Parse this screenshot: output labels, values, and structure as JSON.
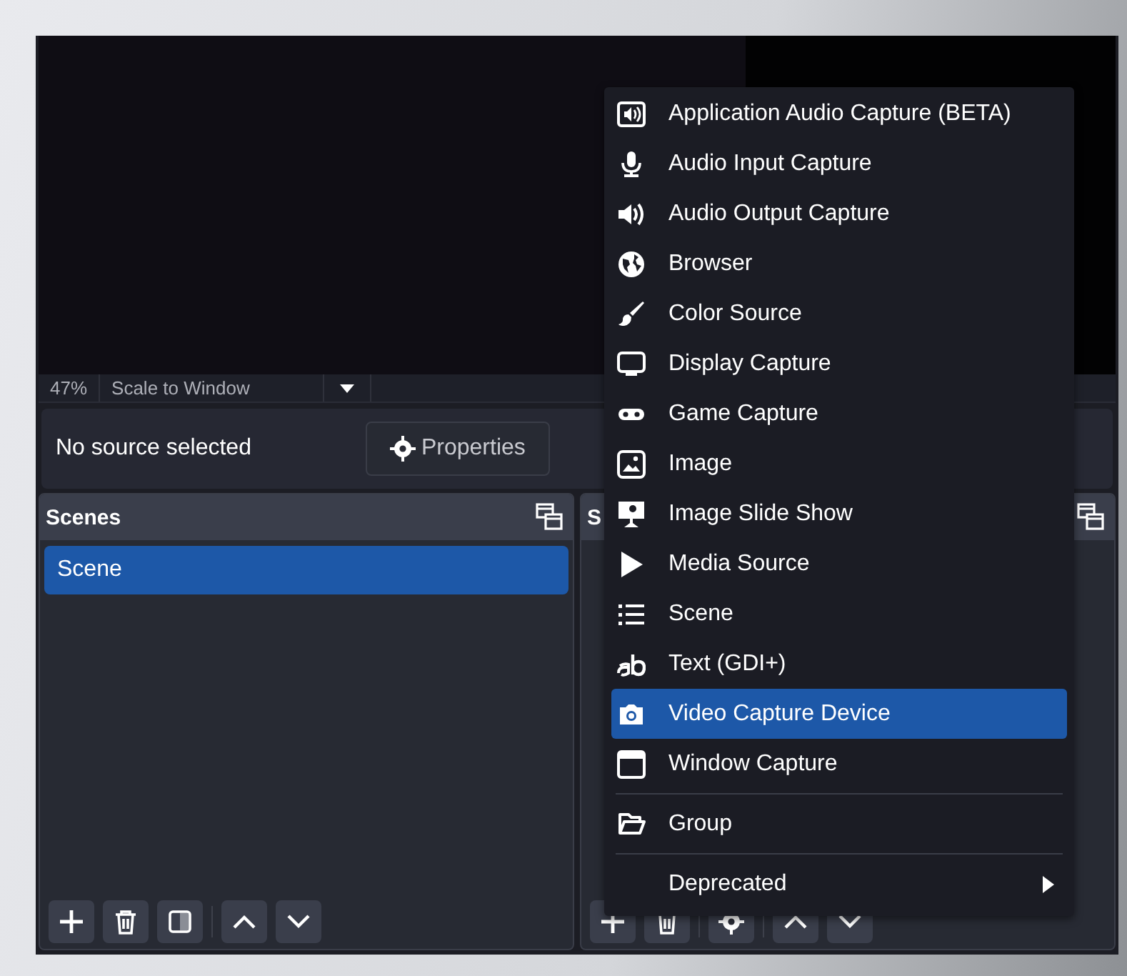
{
  "preview": {
    "zoom": "47%",
    "scale_mode": "Scale to Window"
  },
  "source_bar": {
    "status": "No source selected",
    "properties_button": "Properties"
  },
  "docks": [
    {
      "title": "Scenes",
      "items": [
        {
          "label": "Scene",
          "selected": true
        }
      ],
      "toolbar": [
        {
          "kind": "add"
        },
        {
          "kind": "remove"
        },
        {
          "kind": "filters"
        },
        {
          "kind": "separator"
        },
        {
          "kind": "up"
        },
        {
          "kind": "down"
        }
      ]
    },
    {
      "title": "S",
      "toolbar": [
        {
          "kind": "add"
        },
        {
          "kind": "remove"
        },
        {
          "kind": "separator"
        },
        {
          "kind": "settings"
        },
        {
          "kind": "separator"
        },
        {
          "kind": "up"
        },
        {
          "kind": "down"
        }
      ]
    }
  ],
  "add_source_menu": [
    {
      "kind": "item",
      "label": "Application Audio Capture (BETA)",
      "selected": false
    },
    {
      "kind": "item",
      "label": "Audio Input Capture",
      "selected": false
    },
    {
      "kind": "item",
      "label": "Audio Output Capture",
      "selected": false
    },
    {
      "kind": "item",
      "label": "Browser",
      "selected": false
    },
    {
      "kind": "item",
      "label": "Color Source",
      "selected": false
    },
    {
      "kind": "item",
      "label": "Display Capture",
      "selected": false
    },
    {
      "kind": "item",
      "label": "Game Capture",
      "selected": false
    },
    {
      "kind": "item",
      "label": "Image",
      "selected": false
    },
    {
      "kind": "item",
      "label": "Image Slide Show",
      "selected": false
    },
    {
      "kind": "item",
      "label": "Media Source",
      "selected": false
    },
    {
      "kind": "item",
      "label": "Scene",
      "selected": false
    },
    {
      "kind": "item",
      "label": "Text (GDI+)",
      "selected": false
    },
    {
      "kind": "item",
      "label": "Video Capture Device",
      "selected": true
    },
    {
      "kind": "item",
      "label": "Window Capture",
      "selected": false
    },
    {
      "kind": "separator"
    },
    {
      "kind": "item",
      "label": "Group",
      "selected": false
    },
    {
      "kind": "separator"
    },
    {
      "kind": "submenu",
      "label": "Deprecated",
      "selected": false
    }
  ]
}
